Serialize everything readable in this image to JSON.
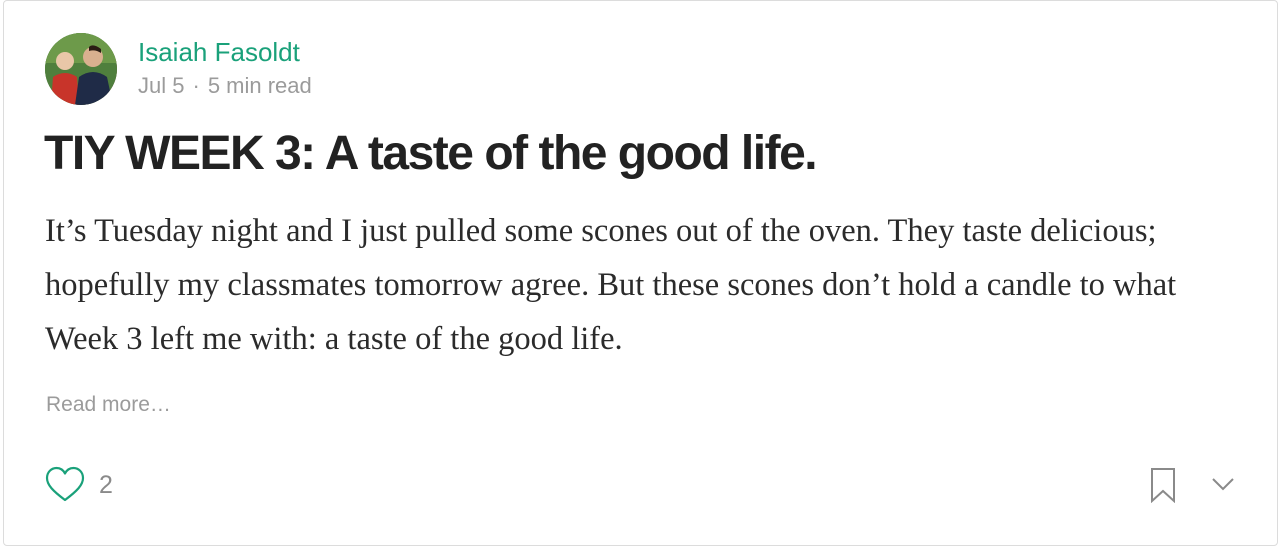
{
  "post": {
    "author": "Isaiah Fasoldt",
    "date": "Jul 5",
    "separator": "·",
    "read_time": "5 min read",
    "title": "TIY WEEK 3: A taste of the good life.",
    "excerpt": "It’s Tuesday night and I just pulled some scones out of the oven. They taste delicious; hopefully my classmates tomorrow agree. But these scones don’t hold a candle to what Week 3 left me with: a taste of the good life.",
    "read_more": "Read more…"
  },
  "actions": {
    "like_icon": "heart-outline-icon",
    "like_count": "2",
    "bookmark_icon": "bookmark-outline-icon",
    "more_icon": "chevron-down-icon"
  },
  "colors": {
    "accent": "#1aa17a",
    "title": "#222222",
    "body": "#2b2b2b",
    "muted": "#9b9b9b",
    "border": "#dcdcdc"
  }
}
